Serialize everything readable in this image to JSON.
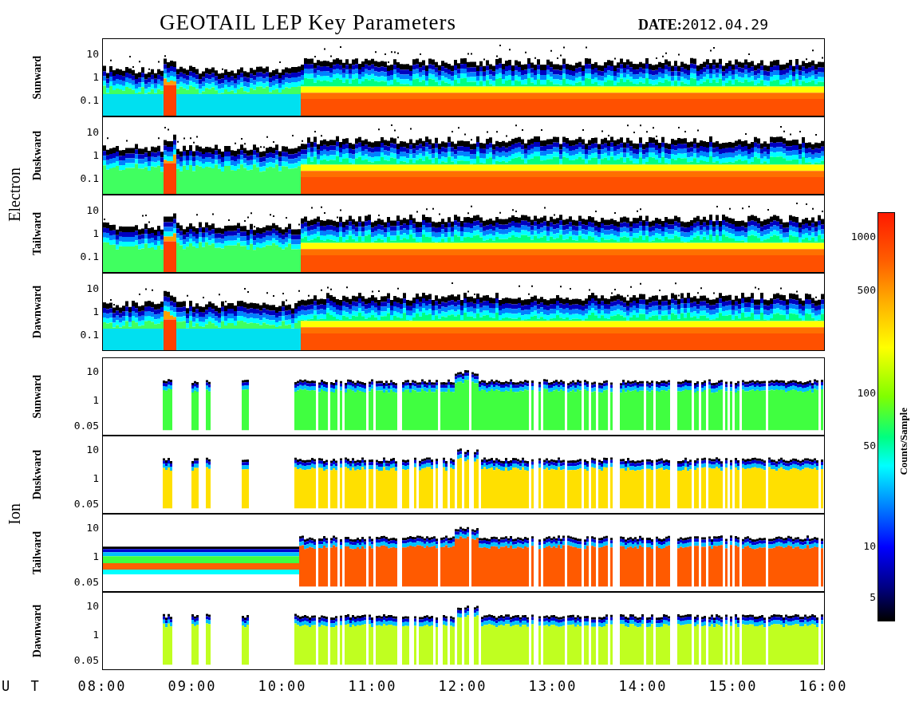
{
  "title": "GEOTAIL LEP Key Parameters",
  "date": {
    "label": "DATE:",
    "value": "2012.04.29"
  },
  "groups": [
    {
      "name": "Electron",
      "kind": "electron",
      "panels": [
        {
          "direction": "Sunward",
          "yticks": [
            "10",
            "1",
            "0.1"
          ]
        },
        {
          "direction": "Duskward",
          "yticks": [
            "10",
            "1",
            "0.1"
          ]
        },
        {
          "direction": "Tailward",
          "yticks": [
            "10",
            "1",
            "0.1"
          ]
        },
        {
          "direction": "Dawnward",
          "yticks": [
            "10",
            "1",
            "0.1"
          ]
        }
      ]
    },
    {
      "name": "Ion",
      "kind": "ion",
      "panels": [
        {
          "direction": "Sunward",
          "yticks": [
            "10",
            "1",
            "0.05"
          ]
        },
        {
          "direction": "Duskward",
          "yticks": [
            "10",
            "1",
            "0.05"
          ]
        },
        {
          "direction": "Tailward",
          "yticks": [
            "10",
            "1",
            "0.05"
          ]
        },
        {
          "direction": "Dawnward",
          "yticks": [
            "10",
            "1",
            "0.05"
          ]
        }
      ]
    }
  ],
  "x_axis": {
    "label": "U T",
    "ticks": [
      "08:00",
      "09:00",
      "10:00",
      "11:00",
      "12:00",
      "13:00",
      "14:00",
      "15:00",
      "16:00"
    ]
  },
  "colorbar": {
    "label": "Counts/Sample",
    "ticks": [
      "1000",
      "500",
      "100",
      "50",
      "10",
      "5"
    ]
  }
}
